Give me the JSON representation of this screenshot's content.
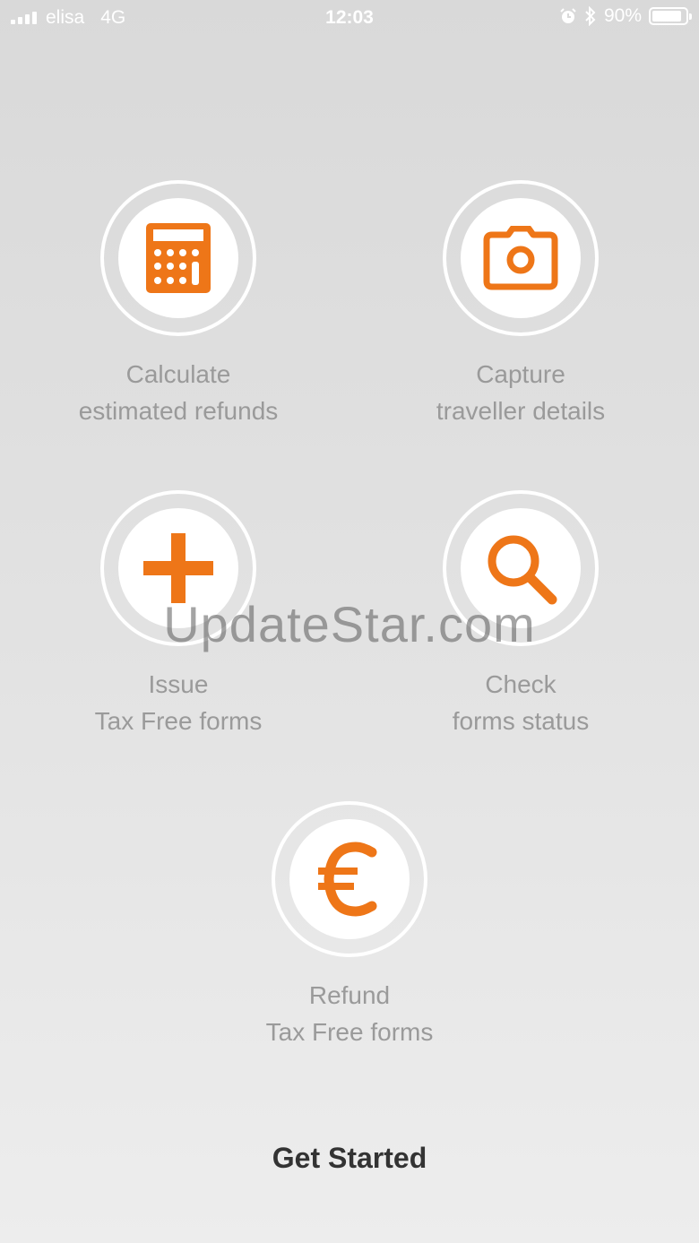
{
  "status_bar": {
    "carrier": "elisa",
    "network": "4G",
    "time": "12:03",
    "battery": "90%",
    "battery_level": 0.9,
    "icons": [
      "signal-icon",
      "alarm-icon",
      "bluetooth-icon",
      "battery-icon"
    ]
  },
  "features": [
    {
      "line1": "Calculate",
      "line2": "estimated refunds",
      "icon": "calculator-icon"
    },
    {
      "line1": "Capture",
      "line2": "traveller details",
      "icon": "camera-icon"
    },
    {
      "line1": "Issue",
      "line2": "Tax Free forms",
      "icon": "plus-icon"
    },
    {
      "line1": "Check",
      "line2": "forms status",
      "icon": "search-icon"
    },
    {
      "line1": "Refund",
      "line2": "Tax Free forms",
      "icon": "euro-icon"
    }
  ],
  "watermark": "UpdateStar.com",
  "cta": {
    "label": "Get Started"
  },
  "colors": {
    "accent": "#ee7618",
    "label": "#9a9a9a",
    "cta": "#333333"
  }
}
